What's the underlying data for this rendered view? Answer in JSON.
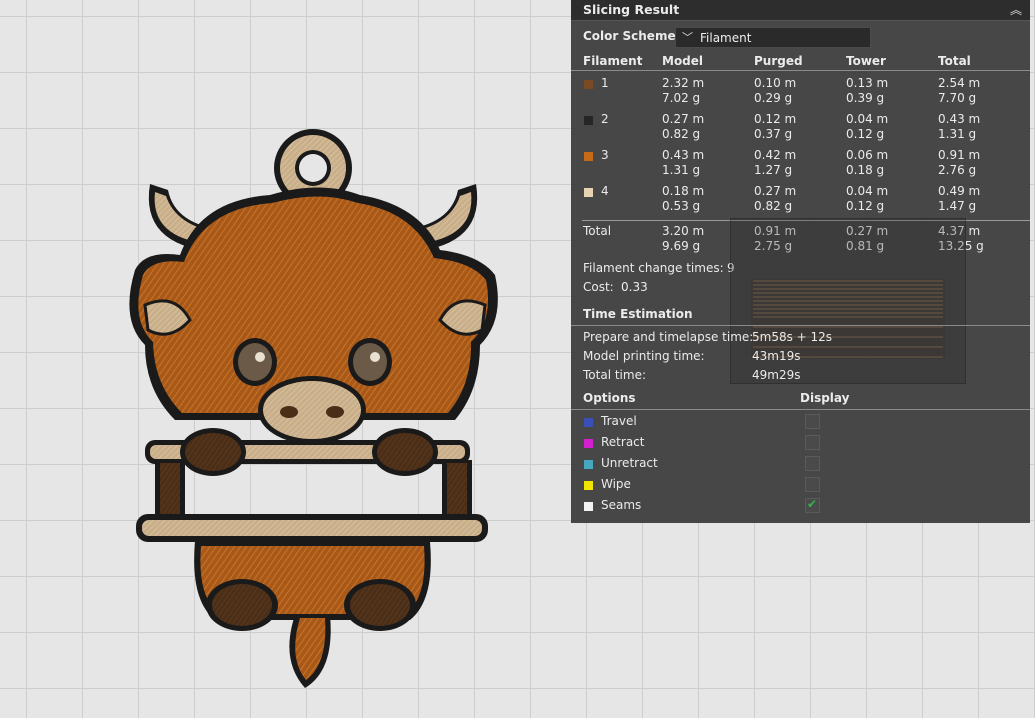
{
  "panel": {
    "title": "Slicing Result",
    "color_scheme_label": "Color Scheme",
    "color_scheme_value": "Filament",
    "columns": [
      "Filament",
      "Model",
      "Purged",
      "Tower",
      "Total"
    ],
    "filaments": [
      {
        "id": "1",
        "color": "#7a4a22",
        "model_m": "2.32 m",
        "model_g": "7.02 g",
        "purged_m": "0.10 m",
        "purged_g": "0.29 g",
        "tower_m": "0.13 m",
        "tower_g": "0.39 g",
        "total_m": "2.54 m",
        "total_g": "7.70 g"
      },
      {
        "id": "2",
        "color": "#262626",
        "model_m": "0.27 m",
        "model_g": "0.82 g",
        "purged_m": "0.12 m",
        "purged_g": "0.37 g",
        "tower_m": "0.04 m",
        "tower_g": "0.12 g",
        "total_m": "0.43 m",
        "total_g": "1.31 g"
      },
      {
        "id": "3",
        "color": "#c56a17",
        "model_m": "0.43 m",
        "model_g": "1.31 g",
        "purged_m": "0.42 m",
        "purged_g": "1.27 g",
        "tower_m": "0.06 m",
        "tower_g": "0.18 g",
        "total_m": "0.91 m",
        "total_g": "2.76 g"
      },
      {
        "id": "4",
        "color": "#e8d3b0",
        "model_m": "0.18 m",
        "model_g": "0.53 g",
        "purged_m": "0.27 m",
        "purged_g": "0.82 g",
        "tower_m": "0.04 m",
        "tower_g": "0.12 g",
        "total_m": "0.49 m",
        "total_g": "1.47 g"
      }
    ],
    "total": {
      "label": "Total",
      "model_m": "3.20 m",
      "model_g": "9.69 g",
      "purged_m": "0.91 m",
      "purged_g": "2.75 g",
      "tower_m": "0.27 m",
      "tower_g": "0.81 g",
      "total_m": "4.37 m",
      "total_g": "13.25 g"
    },
    "filament_change_label": "Filament change times:",
    "filament_change_value": "9",
    "cost_label": "Cost:",
    "cost_value": "0.33",
    "time_estimation": {
      "title": "Time Estimation",
      "prepare_label": "Prepare and timelapse time:",
      "prepare_value": "5m58s + 12s",
      "model_label": "Model printing time:",
      "model_value": "43m19s",
      "total_label": "Total time:",
      "total_value": "49m29s"
    },
    "options": {
      "title": "Options",
      "display_title": "Display",
      "items": [
        {
          "label": "Travel",
          "color": "#3b4fb8",
          "checked": false
        },
        {
          "label": "Retract",
          "color": "#d21fcf",
          "checked": false
        },
        {
          "label": "Unretract",
          "color": "#45a8c0",
          "checked": false
        },
        {
          "label": "Wipe",
          "color": "#f0e400",
          "checked": false
        },
        {
          "label": "Seams",
          "color": "#f2f2f2",
          "checked": true,
          "check_glyph": "✔"
        }
      ]
    }
  }
}
